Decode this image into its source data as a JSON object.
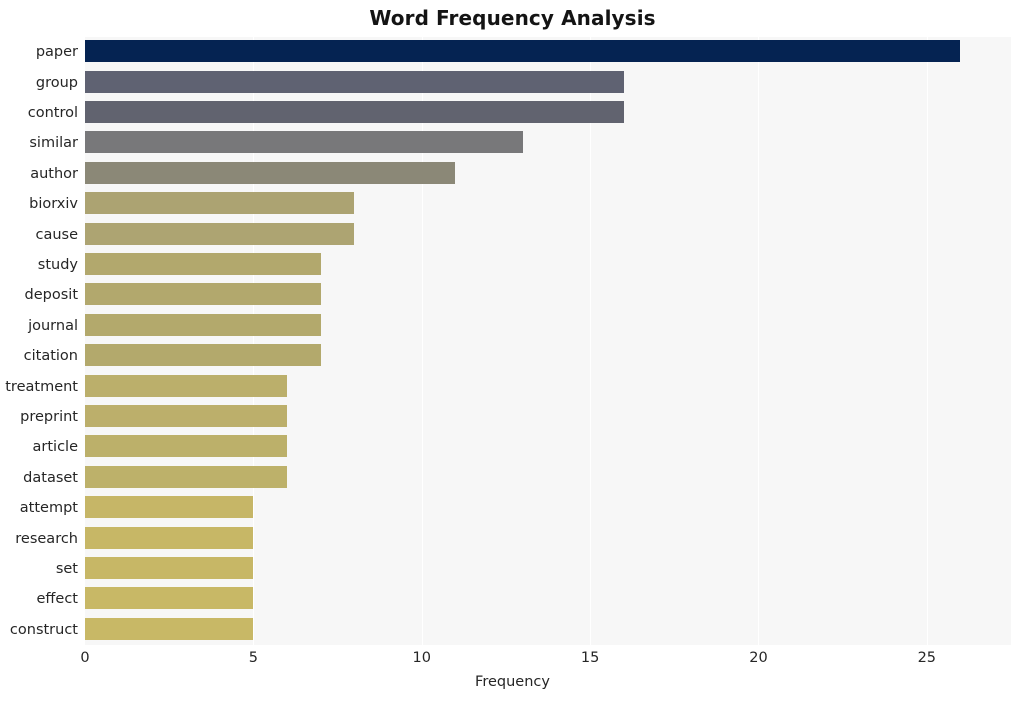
{
  "chart_data": {
    "type": "bar",
    "orientation": "horizontal",
    "title": "Word Frequency Analysis",
    "xlabel": "Frequency",
    "ylabel": "",
    "categories": [
      "paper",
      "group",
      "control",
      "similar",
      "author",
      "biorxiv",
      "cause",
      "study",
      "deposit",
      "journal",
      "citation",
      "treatment",
      "preprint",
      "article",
      "dataset",
      "attempt",
      "research",
      "set",
      "effect",
      "construct"
    ],
    "values": [
      26,
      16,
      16,
      13,
      11,
      8,
      8,
      7,
      7,
      7,
      7,
      6,
      6,
      6,
      6,
      5,
      5,
      5,
      5,
      5
    ],
    "bar_colors": [
      "#052352",
      "#5f6272",
      "#61636f",
      "#78787a",
      "#8b8877",
      "#aca372",
      "#ada472",
      "#b2a86d",
      "#b2a86d",
      "#b3a96c",
      "#b3a96c",
      "#bbaf6b",
      "#bcaf6b",
      "#bcb06a",
      "#bdb16a",
      "#c6b667",
      "#c7b766",
      "#c7b766",
      "#c8b866",
      "#c8b866"
    ],
    "xlim": [
      0,
      27.5
    ],
    "xticks": [
      0,
      5,
      10,
      15,
      20,
      25
    ],
    "xtick_labels": [
      "0",
      "5",
      "10",
      "15",
      "20",
      "25"
    ],
    "grid": true,
    "grid_color": "#ffffff",
    "plot_background": "#f7f7f7",
    "figure_background": "#ffffff",
    "legend": null
  }
}
